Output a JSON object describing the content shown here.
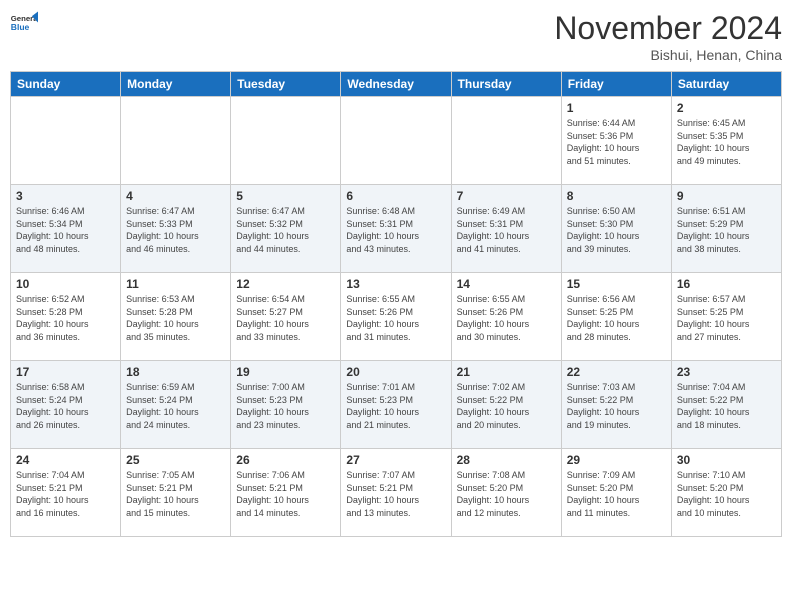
{
  "logo": {
    "general": "General",
    "blue": "Blue"
  },
  "header": {
    "month": "November 2024",
    "location": "Bishui, Henan, China"
  },
  "weekdays": [
    "Sunday",
    "Monday",
    "Tuesday",
    "Wednesday",
    "Thursday",
    "Friday",
    "Saturday"
  ],
  "weeks": [
    [
      {
        "day": "",
        "info": ""
      },
      {
        "day": "",
        "info": ""
      },
      {
        "day": "",
        "info": ""
      },
      {
        "day": "",
        "info": ""
      },
      {
        "day": "",
        "info": ""
      },
      {
        "day": "1",
        "info": "Sunrise: 6:44 AM\nSunset: 5:36 PM\nDaylight: 10 hours\nand 51 minutes."
      },
      {
        "day": "2",
        "info": "Sunrise: 6:45 AM\nSunset: 5:35 PM\nDaylight: 10 hours\nand 49 minutes."
      }
    ],
    [
      {
        "day": "3",
        "info": "Sunrise: 6:46 AM\nSunset: 5:34 PM\nDaylight: 10 hours\nand 48 minutes."
      },
      {
        "day": "4",
        "info": "Sunrise: 6:47 AM\nSunset: 5:33 PM\nDaylight: 10 hours\nand 46 minutes."
      },
      {
        "day": "5",
        "info": "Sunrise: 6:47 AM\nSunset: 5:32 PM\nDaylight: 10 hours\nand 44 minutes."
      },
      {
        "day": "6",
        "info": "Sunrise: 6:48 AM\nSunset: 5:31 PM\nDaylight: 10 hours\nand 43 minutes."
      },
      {
        "day": "7",
        "info": "Sunrise: 6:49 AM\nSunset: 5:31 PM\nDaylight: 10 hours\nand 41 minutes."
      },
      {
        "day": "8",
        "info": "Sunrise: 6:50 AM\nSunset: 5:30 PM\nDaylight: 10 hours\nand 39 minutes."
      },
      {
        "day": "9",
        "info": "Sunrise: 6:51 AM\nSunset: 5:29 PM\nDaylight: 10 hours\nand 38 minutes."
      }
    ],
    [
      {
        "day": "10",
        "info": "Sunrise: 6:52 AM\nSunset: 5:28 PM\nDaylight: 10 hours\nand 36 minutes."
      },
      {
        "day": "11",
        "info": "Sunrise: 6:53 AM\nSunset: 5:28 PM\nDaylight: 10 hours\nand 35 minutes."
      },
      {
        "day": "12",
        "info": "Sunrise: 6:54 AM\nSunset: 5:27 PM\nDaylight: 10 hours\nand 33 minutes."
      },
      {
        "day": "13",
        "info": "Sunrise: 6:55 AM\nSunset: 5:26 PM\nDaylight: 10 hours\nand 31 minutes."
      },
      {
        "day": "14",
        "info": "Sunrise: 6:55 AM\nSunset: 5:26 PM\nDaylight: 10 hours\nand 30 minutes."
      },
      {
        "day": "15",
        "info": "Sunrise: 6:56 AM\nSunset: 5:25 PM\nDaylight: 10 hours\nand 28 minutes."
      },
      {
        "day": "16",
        "info": "Sunrise: 6:57 AM\nSunset: 5:25 PM\nDaylight: 10 hours\nand 27 minutes."
      }
    ],
    [
      {
        "day": "17",
        "info": "Sunrise: 6:58 AM\nSunset: 5:24 PM\nDaylight: 10 hours\nand 26 minutes."
      },
      {
        "day": "18",
        "info": "Sunrise: 6:59 AM\nSunset: 5:24 PM\nDaylight: 10 hours\nand 24 minutes."
      },
      {
        "day": "19",
        "info": "Sunrise: 7:00 AM\nSunset: 5:23 PM\nDaylight: 10 hours\nand 23 minutes."
      },
      {
        "day": "20",
        "info": "Sunrise: 7:01 AM\nSunset: 5:23 PM\nDaylight: 10 hours\nand 21 minutes."
      },
      {
        "day": "21",
        "info": "Sunrise: 7:02 AM\nSunset: 5:22 PM\nDaylight: 10 hours\nand 20 minutes."
      },
      {
        "day": "22",
        "info": "Sunrise: 7:03 AM\nSunset: 5:22 PM\nDaylight: 10 hours\nand 19 minutes."
      },
      {
        "day": "23",
        "info": "Sunrise: 7:04 AM\nSunset: 5:22 PM\nDaylight: 10 hours\nand 18 minutes."
      }
    ],
    [
      {
        "day": "24",
        "info": "Sunrise: 7:04 AM\nSunset: 5:21 PM\nDaylight: 10 hours\nand 16 minutes."
      },
      {
        "day": "25",
        "info": "Sunrise: 7:05 AM\nSunset: 5:21 PM\nDaylight: 10 hours\nand 15 minutes."
      },
      {
        "day": "26",
        "info": "Sunrise: 7:06 AM\nSunset: 5:21 PM\nDaylight: 10 hours\nand 14 minutes."
      },
      {
        "day": "27",
        "info": "Sunrise: 7:07 AM\nSunset: 5:21 PM\nDaylight: 10 hours\nand 13 minutes."
      },
      {
        "day": "28",
        "info": "Sunrise: 7:08 AM\nSunset: 5:20 PM\nDaylight: 10 hours\nand 12 minutes."
      },
      {
        "day": "29",
        "info": "Sunrise: 7:09 AM\nSunset: 5:20 PM\nDaylight: 10 hours\nand 11 minutes."
      },
      {
        "day": "30",
        "info": "Sunrise: 7:10 AM\nSunset: 5:20 PM\nDaylight: 10 hours\nand 10 minutes."
      }
    ]
  ]
}
